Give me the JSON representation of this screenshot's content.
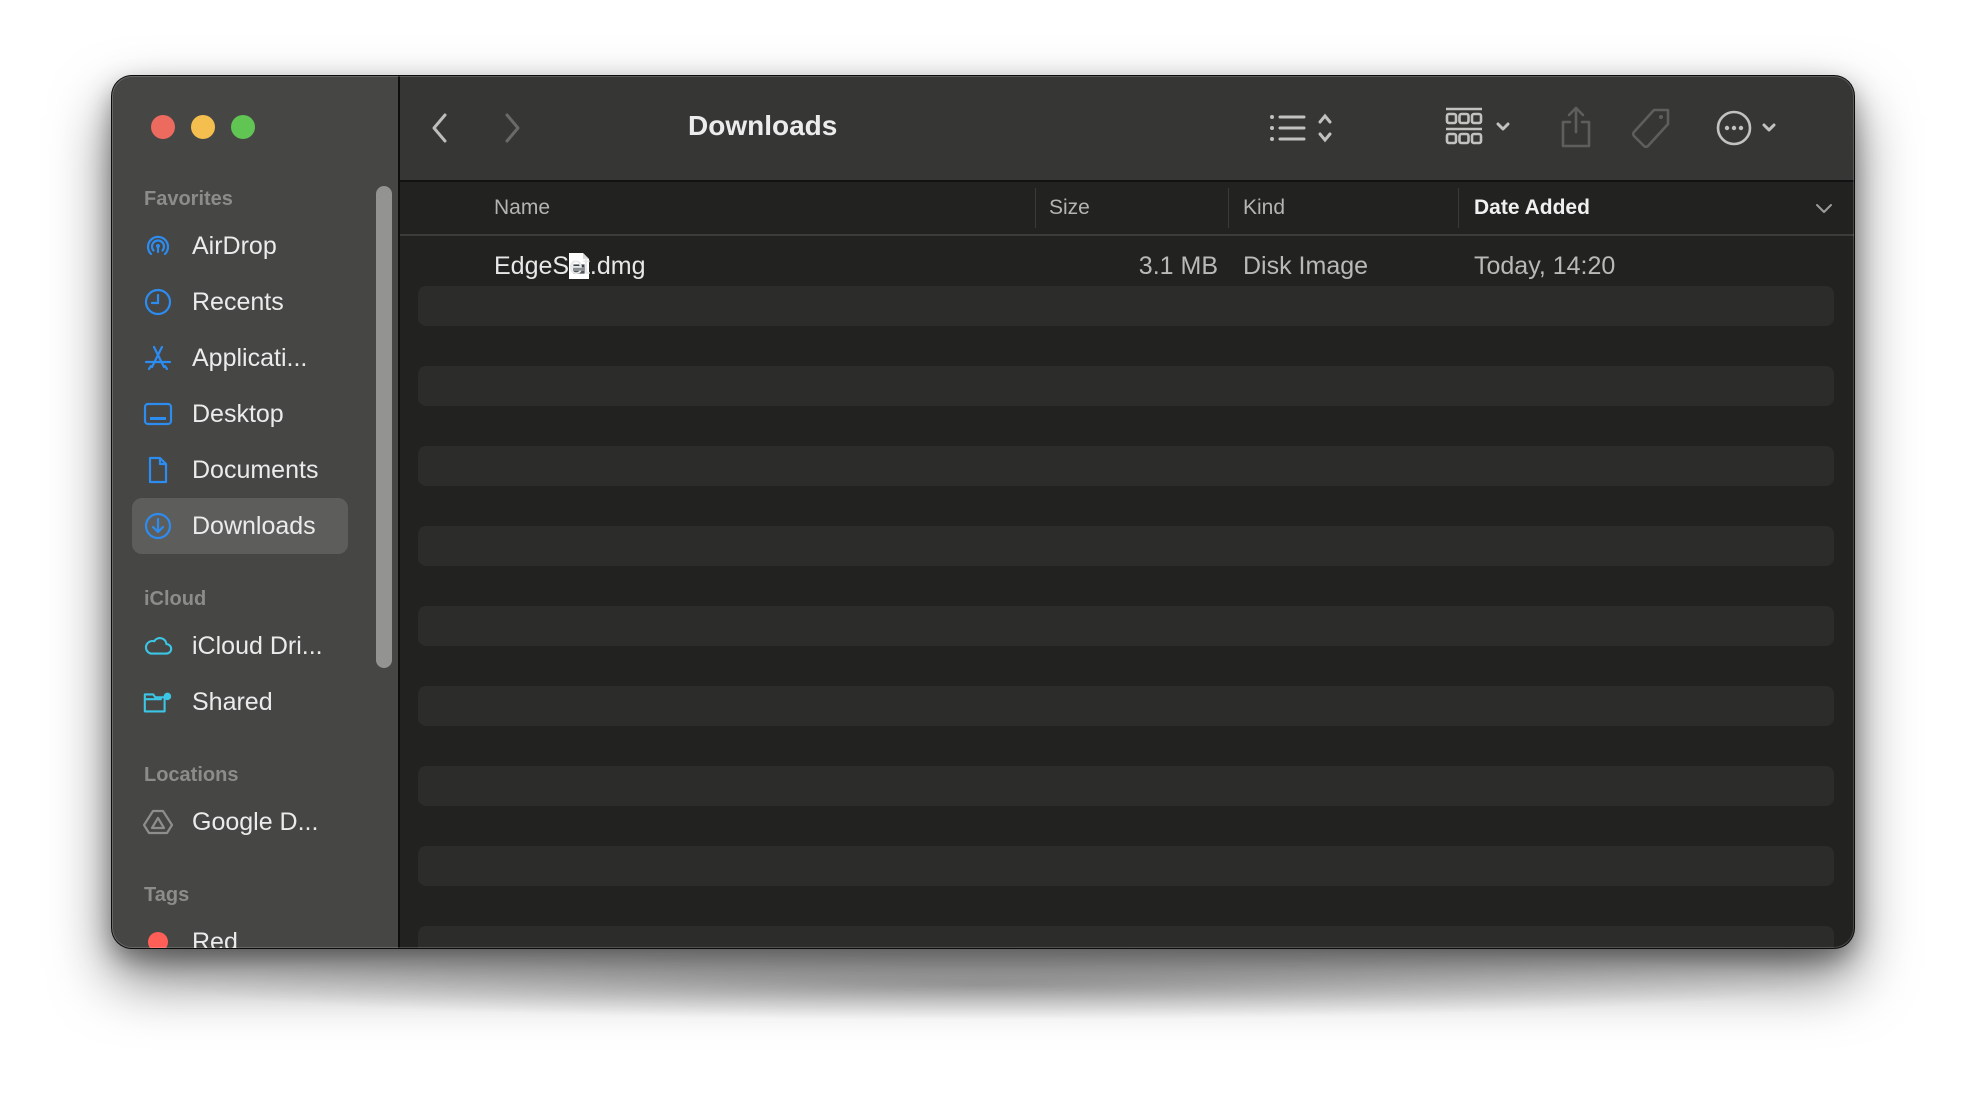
{
  "window": {
    "title": "Downloads",
    "traffic_lights": {
      "close": "#ed6a5e",
      "minimize": "#f4bf4f",
      "maximize": "#61c554"
    }
  },
  "toolbar": {
    "back_icon": "chevron-left-icon",
    "forward_icon": "chevron-right-icon",
    "view_icon": "list-view-icon",
    "group_icon": "gallery-group-icon",
    "share_icon": "share-icon",
    "tag_icon": "tag-icon",
    "more_icon": "ellipsis-circle-icon",
    "search_icon": "search-icon"
  },
  "sidebar": {
    "accent": "#2d8cf0",
    "icloud_accent": "#3cc6e6",
    "sections": {
      "favorites": "Favorites",
      "icloud": "iCloud",
      "locations": "Locations",
      "tags": "Tags"
    },
    "favorites": [
      {
        "label": "AirDrop",
        "icon": "airdrop-icon"
      },
      {
        "label": "Recents",
        "icon": "clock-icon"
      },
      {
        "label": "Applicati...",
        "icon": "applications-icon"
      },
      {
        "label": "Desktop",
        "icon": "desktop-icon"
      },
      {
        "label": "Documents",
        "icon": "document-icon"
      },
      {
        "label": "Downloads",
        "icon": "download-icon",
        "selected": true
      }
    ],
    "icloud": [
      {
        "label": "iCloud Dri...",
        "icon": "cloud-icon"
      },
      {
        "label": "Shared",
        "icon": "shared-folder-icon"
      }
    ],
    "locations": [
      {
        "label": "Google D...",
        "icon": "google-drive-icon"
      }
    ],
    "tags": [
      {
        "label": "Red",
        "color": "#ff5f57"
      }
    ]
  },
  "table": {
    "columns": {
      "name": "Name",
      "size": "Size",
      "kind": "Kind",
      "date_added": "Date Added"
    },
    "sorted_by": "Date Added",
    "rows": [
      {
        "name": "EdgeSet.dmg",
        "size": "3.1 MB",
        "kind": "Disk Image",
        "date_added": "Today, 14:20",
        "icon": "disk-image-file-icon"
      }
    ]
  }
}
